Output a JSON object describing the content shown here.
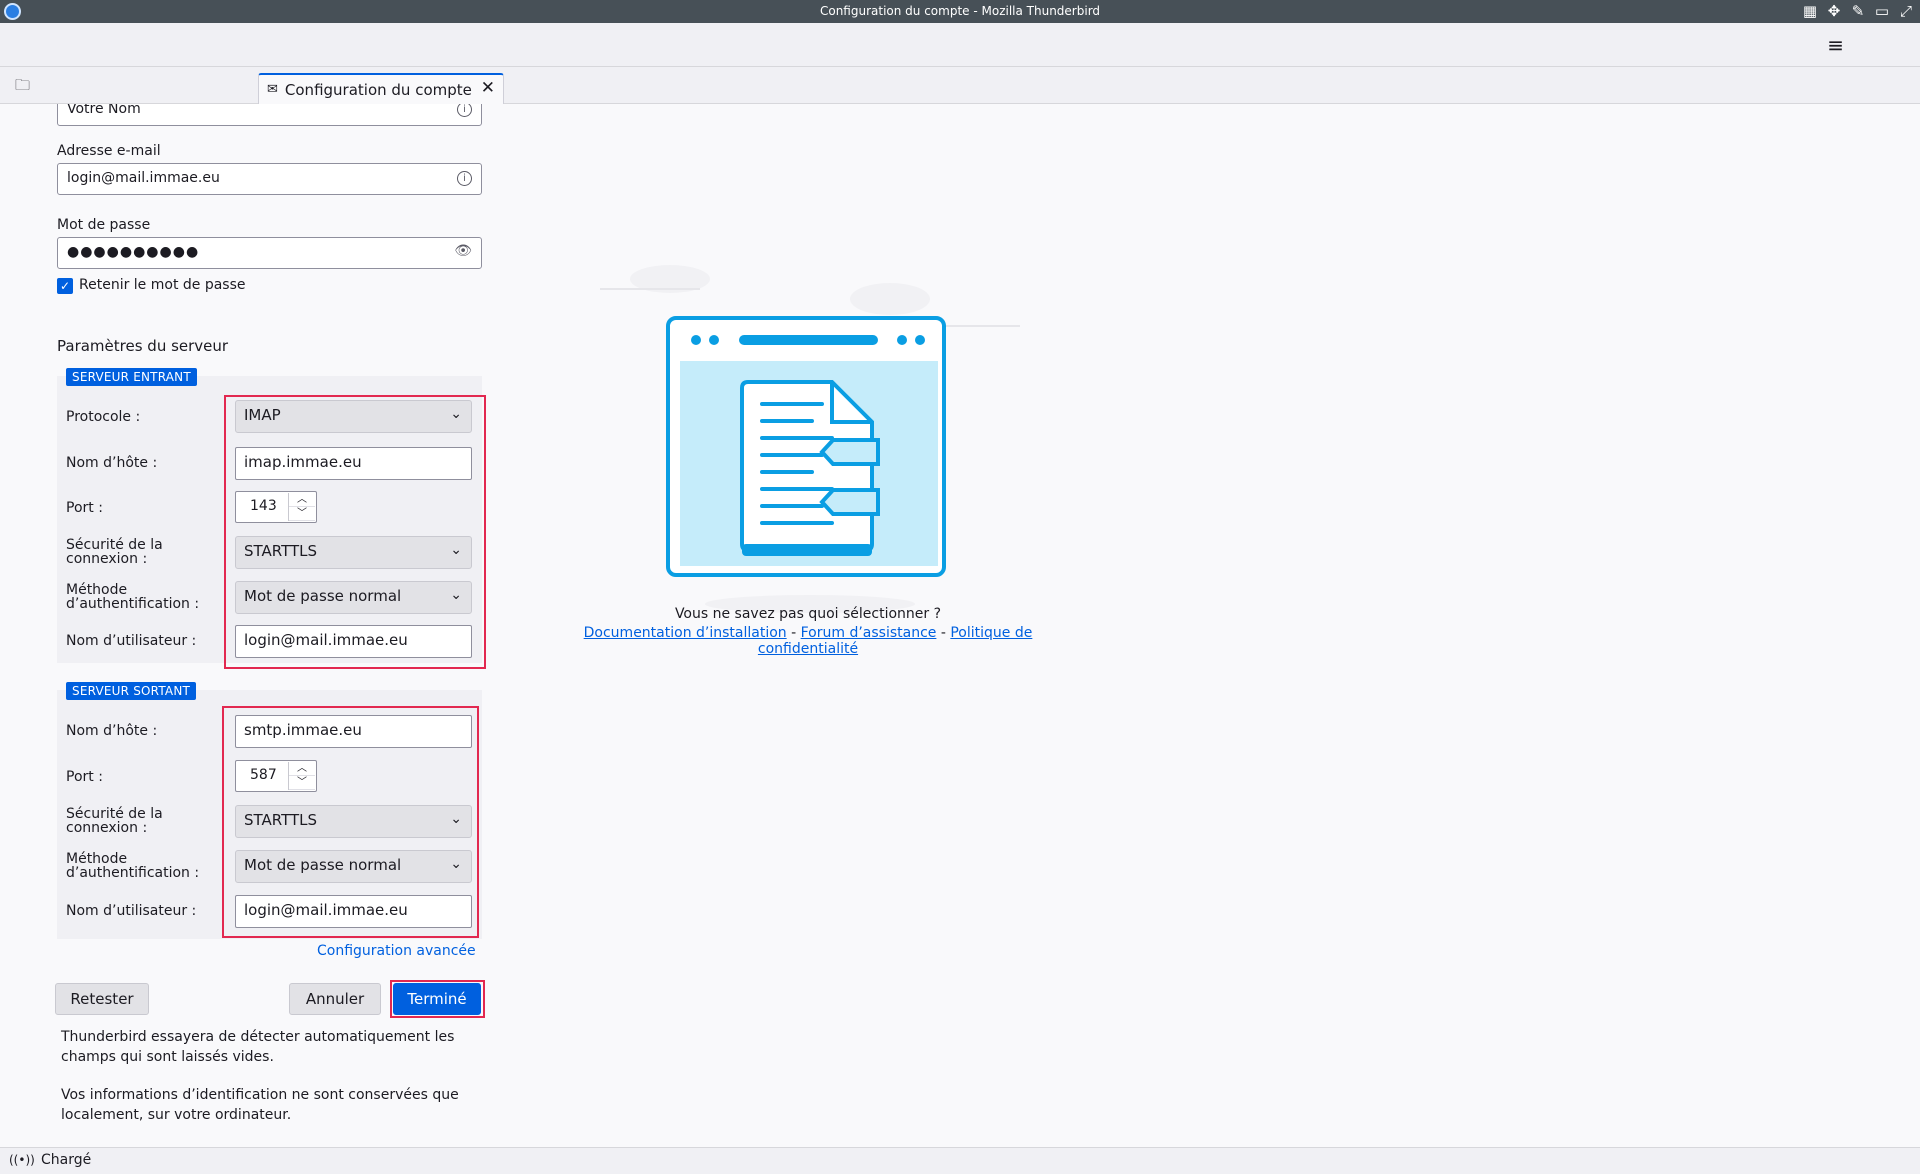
{
  "window": {
    "title": "Configuration du compte - Mozilla Thunderbird"
  },
  "tab": {
    "label": "Configuration du compte"
  },
  "form": {
    "name_value": "Votre Nom",
    "email_label": "Adresse e-mail",
    "email_value": "login@mail.immae.eu",
    "password_label": "Mot de passe",
    "password_mask": "●●●●●●●●●●",
    "remember_label": "Retenir le mot de passe",
    "remember_checked": true,
    "server_settings_title": "Paramètres du serveur"
  },
  "incoming": {
    "badge": "SERVEUR ENTRANT",
    "protocol_label": "Protocole :",
    "protocol_value": "IMAP",
    "hostname_label": "Nom d’hôte :",
    "hostname_value": "imap.immae.eu",
    "port_label": "Port :",
    "port_value": "143",
    "security_label_line1": "Sécurité de la",
    "security_label_line2": "connexion :",
    "security_value": "STARTTLS",
    "auth_label_line1": "Méthode",
    "auth_label_line2": "d’authentification :",
    "auth_value": "Mot de passe normal",
    "username_label": "Nom d’utilisateur :",
    "username_value": "login@mail.immae.eu"
  },
  "outgoing": {
    "badge": "SERVEUR SORTANT",
    "hostname_label": "Nom d’hôte :",
    "hostname_value": "smtp.immae.eu",
    "port_label": "Port :",
    "port_value": "587",
    "security_label_line1": "Sécurité de la",
    "security_label_line2": "connexion :",
    "security_value": "STARTTLS",
    "auth_label_line1": "Méthode",
    "auth_label_line2": "d’authentification :",
    "auth_value": "Mot de passe normal",
    "username_label": "Nom d’utilisateur :",
    "username_value": "login@mail.immae.eu"
  },
  "actions": {
    "advanced_config": "Configuration avancée",
    "retest": "Retester",
    "cancel": "Annuler",
    "done": "Terminé"
  },
  "notes": {
    "line1": "Thunderbird essayera de détecter automatiquement les champs qui sont laissés vides.",
    "line2": "Vos informations d’identification ne sont conservées que localement, sur votre ordinateur."
  },
  "help": {
    "title": "Vous ne savez pas quoi sélectionner ?",
    "doc_link": "Documentation d’installation",
    "forum_link": "Forum d’assistance",
    "privacy_link": "Politique de confidentialité",
    "separator": " - "
  },
  "status": {
    "text": "Chargé"
  },
  "icons": {
    "app": "thunderbird-icon",
    "menu": "hamburger-menu-icon",
    "folder": "folder-icon",
    "tab": "account-setup-icon",
    "close": "close-icon",
    "info": "info-icon",
    "eye": "password-visibility-icon",
    "chevron": "chevron-down-icon",
    "signal": "connection-status-icon"
  },
  "colors": {
    "accent": "#0060df",
    "highlight": "#e22850",
    "illustration": "#0a9ee3"
  }
}
